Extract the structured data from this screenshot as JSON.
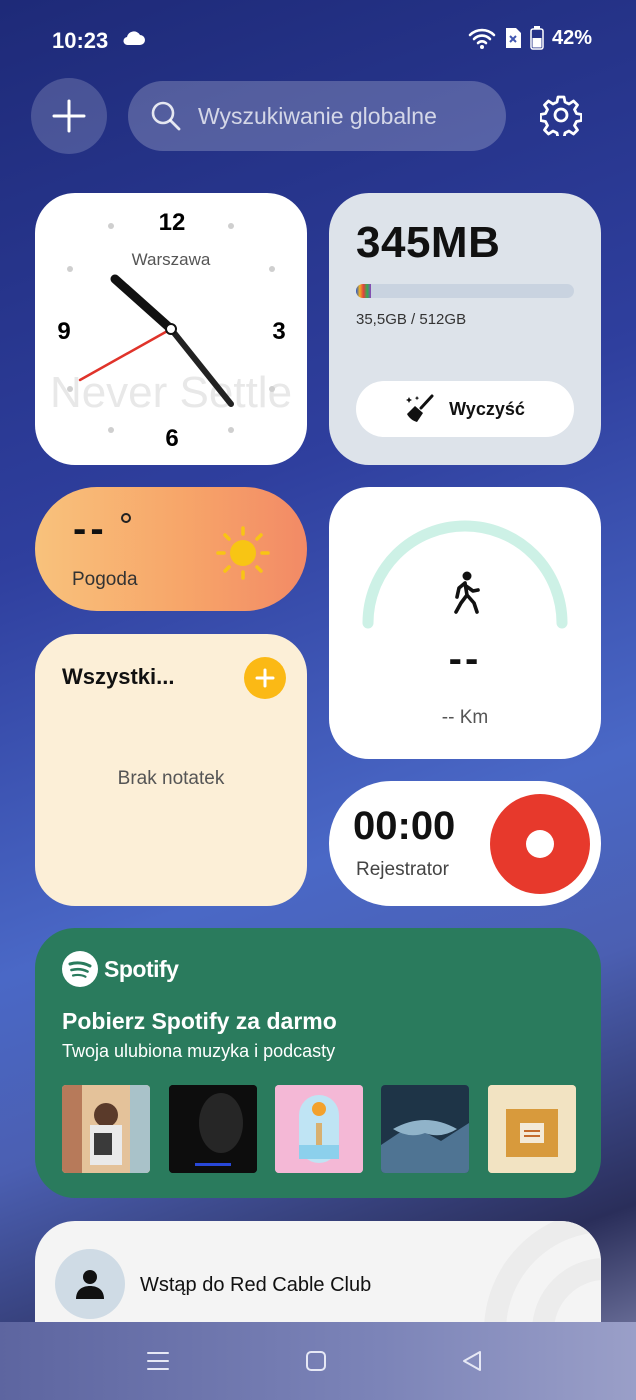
{
  "status_bar": {
    "time": "10:23",
    "battery": "42%",
    "icons": [
      "cloud-icon",
      "wifi-icon",
      "no-sim-icon",
      "battery-icon"
    ]
  },
  "toolbar": {
    "add_icon": "plus-icon",
    "search_placeholder": "Wyszukiwanie globalne",
    "settings_icon": "gear-icon"
  },
  "clock_widget": {
    "city": "Warszawa",
    "numerals": [
      "12",
      "3",
      "6",
      "9"
    ],
    "watermark": "Never Settle",
    "time": "10:23"
  },
  "storage_widget": {
    "value": "345MB",
    "usage_text": "35,5GB / 512GB",
    "usage_fraction": 0.069,
    "clean_label": "Wyczyść"
  },
  "weather_widget": {
    "temperature": "--",
    "label": "Pogoda"
  },
  "steps_widget": {
    "value": "--",
    "distance": "-- Km"
  },
  "notes_widget": {
    "title": "Wszystki...",
    "empty_text": "Brak notatek"
  },
  "recorder_widget": {
    "time": "00:00",
    "label": "Rejestrator"
  },
  "spotify_widget": {
    "brand": "Spotify",
    "title": "Pobierz Spotify za darmo",
    "subtitle": "Twoja ulubiona muzyka i podcasty",
    "albums": [
      {
        "name": "album-1",
        "color": "#d9a57a"
      },
      {
        "name": "album-2",
        "color": "#111111"
      },
      {
        "name": "album-3",
        "color": "#f3b6d4"
      },
      {
        "name": "album-4",
        "color": "#4a6f8f"
      },
      {
        "name": "album-5",
        "color": "#e9c98a"
      }
    ]
  },
  "club_widget": {
    "text": "Wstąp do Red Cable Club"
  },
  "nav_bar": {
    "items": [
      "menu-icon",
      "home-icon",
      "back-icon"
    ]
  }
}
